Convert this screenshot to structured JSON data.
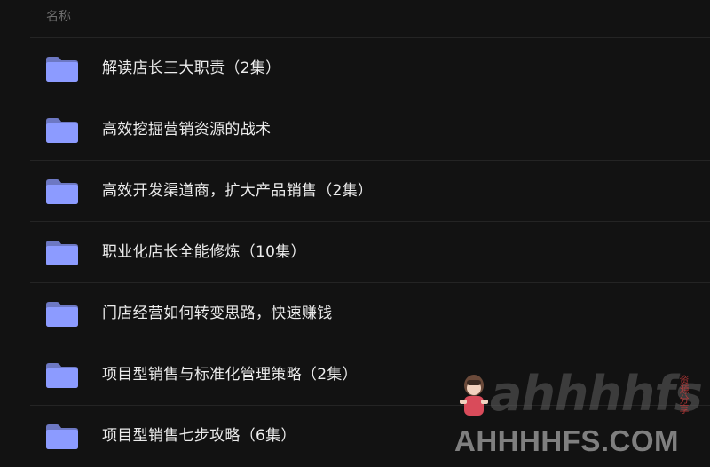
{
  "header": {
    "name_column": "名称"
  },
  "files": [
    {
      "name": "解读店长三大职责（2集）",
      "icon": "folder-icon"
    },
    {
      "name": "高效挖掘营销资源的战术",
      "icon": "folder-icon"
    },
    {
      "name": "高效开发渠道商，扩大产品销售（2集）",
      "icon": "folder-icon"
    },
    {
      "name": "职业化店长全能修炼（10集）",
      "icon": "folder-icon"
    },
    {
      "name": "门店经营如何转变思路，快速赚钱",
      "icon": "folder-icon"
    },
    {
      "name": "项目型销售与标准化管理策略（2集）",
      "icon": "folder-icon"
    },
    {
      "name": "项目型销售七步攻略（6集）",
      "icon": "folder-icon"
    }
  ],
  "watermark": {
    "logo": "ahhhhfs",
    "stamp": "资源分享",
    "site": "AHHHHFS.COM"
  },
  "colors": {
    "background": "#121212",
    "divider": "#242424",
    "text": "#ececec",
    "header_text": "#6f6f6f",
    "folder": "#8c9bff"
  }
}
